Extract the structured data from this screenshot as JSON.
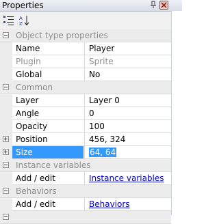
{
  "window": {
    "title": "Properties"
  },
  "toolbar": {
    "buttons": [
      {
        "icon": "categorized-view-icon"
      },
      {
        "icon": "alphabetical-sort-icon"
      }
    ]
  },
  "colors": {
    "selection": "#3399ff",
    "category_bg": "#ececec",
    "disabled_text": "#8d8d8d",
    "link": "#0000cc"
  },
  "categories": {
    "object_type": {
      "label": "Object type properties",
      "rows": {
        "name": {
          "name": "Name",
          "value": "Player"
        },
        "plugin": {
          "name": "Plugin",
          "value": "Sprite"
        },
        "global": {
          "name": "Global",
          "value": "No"
        }
      }
    },
    "common": {
      "label": "Common",
      "rows": {
        "layer": {
          "name": "Layer",
          "value": "Layer 0"
        },
        "angle": {
          "name": "Angle",
          "value": "0"
        },
        "opacity": {
          "name": "Opacity",
          "value": "100"
        },
        "position": {
          "name": "Position",
          "value": "456, 324"
        },
        "size": {
          "name": "Size",
          "value": "64, 64"
        }
      }
    },
    "instance_variables": {
      "label": "Instance variables",
      "rows": {
        "add_edit": {
          "name": "Add / edit",
          "value": "Instance variables"
        }
      }
    },
    "behaviors": {
      "label": "Behaviors",
      "rows": {
        "add_edit": {
          "name": "Add / edit",
          "value": "Behaviors"
        }
      }
    }
  }
}
